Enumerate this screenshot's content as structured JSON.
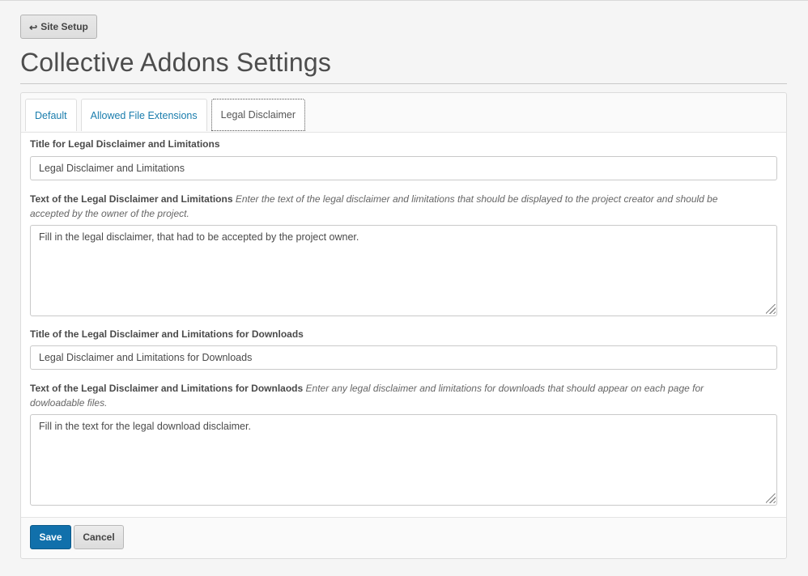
{
  "header": {
    "back_button_label": "Site Setup",
    "page_title": "Collective Addons Settings"
  },
  "tabs": [
    {
      "label": "Default",
      "active": false
    },
    {
      "label": "Allowed File Extensions",
      "active": false
    },
    {
      "label": "Legal Disclaimer",
      "active": true
    }
  ],
  "form": {
    "title_label": "Title for Legal Disclaimer and Limitations",
    "title_value": "Legal Disclaimer and Limitations",
    "text_label": "Text of the Legal Disclaimer and Limitations",
    "text_help": "Enter the text of the legal disclaimer and limitations that should be displayed to the project creator and should be accepted by the owner of the project.",
    "text_value": "Fill in the legal disclaimer, that had to be accepted by the project owner.",
    "downloads_title_label": "Title of the Legal Disclaimer and Limitations for Downloads",
    "downloads_title_value": "Legal Disclaimer and Limitations for Downloads",
    "downloads_text_label": "Text of the Legal Disclaimer and Limitations for Downlaods",
    "downloads_text_help": "Enter any legal disclaimer and limitations for downloads that should appear on each page for dowloadable files.",
    "downloads_text_value": "Fill in the text for the legal download disclaimer."
  },
  "actions": {
    "save_label": "Save",
    "cancel_label": "Cancel"
  },
  "colors": {
    "primary": "#1170ab",
    "link": "#1a7dad"
  }
}
